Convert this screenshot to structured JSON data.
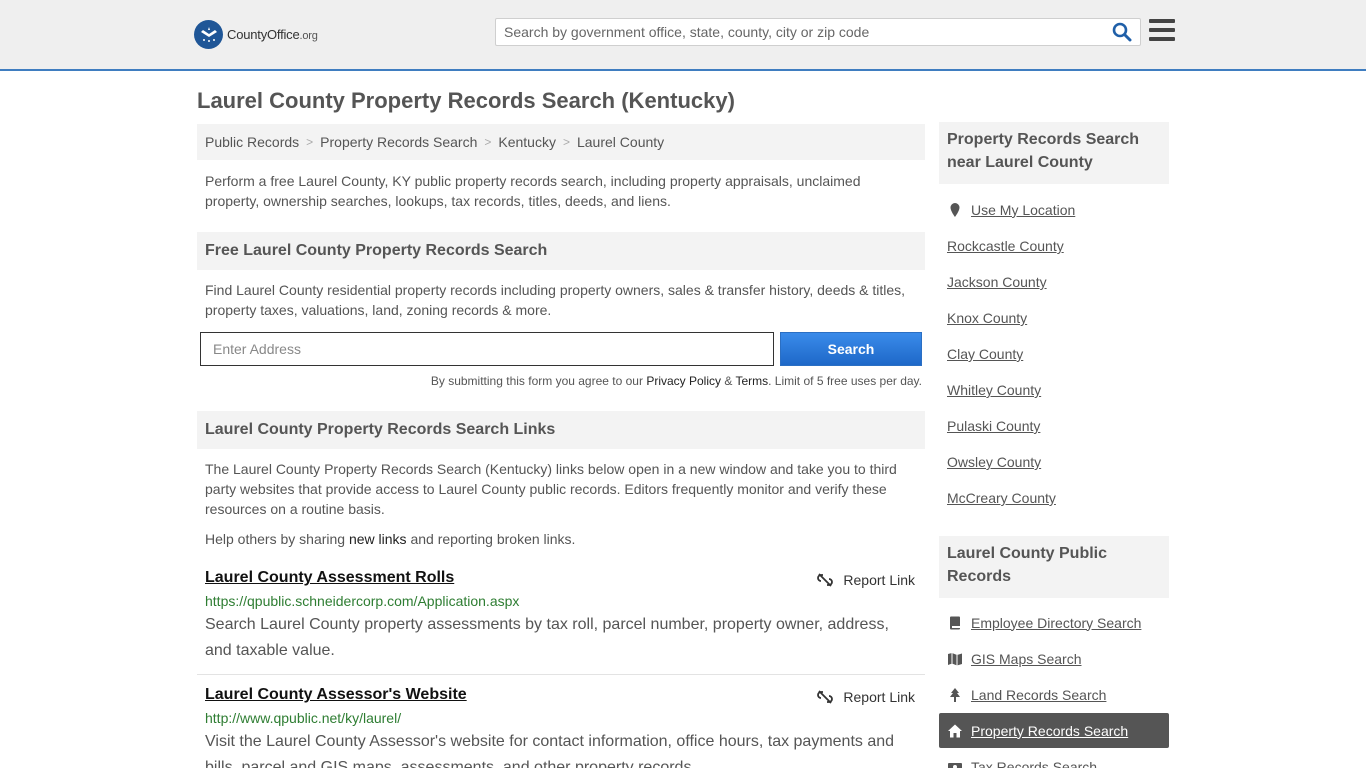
{
  "header": {
    "logo_main": "CountyOffice",
    "logo_tld": ".org",
    "search_placeholder": "Search by government office, state, county, city or zip code"
  },
  "page": {
    "title": "Laurel County Property Records Search (Kentucky)",
    "breadcrumb": [
      "Public Records",
      "Property Records Search",
      "Kentucky",
      "Laurel County"
    ],
    "intro": "Perform a free Laurel County, KY public property records search, including property appraisals, unclaimed property, ownership searches, lookups, tax records, titles, deeds, and liens."
  },
  "free_search": {
    "heading": "Free Laurel County Property Records Search",
    "description": "Find Laurel County residential property records including property owners, sales & transfer history, deeds & titles, property taxes, valuations, land, zoning records & more.",
    "address_placeholder": "Enter Address",
    "button_label": "Search",
    "disclaimer_pre": "By submitting this form you agree to our ",
    "privacy_label": "Privacy Policy",
    "amp": " & ",
    "terms_label": "Terms",
    "disclaimer_post": ". Limit of 5 free uses per day."
  },
  "links_section": {
    "heading": "Laurel County Property Records Search Links",
    "description": "The Laurel County Property Records Search (Kentucky) links below open in a new window and take you to third party websites that provide access to Laurel County public records. Editors frequently monitor and verify these resources on a routine basis.",
    "help_pre": "Help others by sharing ",
    "help_link": "new links",
    "help_post": " and reporting broken links.",
    "report_label": "Report Link",
    "items": [
      {
        "title": "Laurel County Assessment Rolls",
        "url": "https://qpublic.schneidercorp.com/Application.aspx",
        "description": "Search Laurel County property assessments by tax roll, parcel number, property owner, address, and taxable value."
      },
      {
        "title": "Laurel County Assessor's Website",
        "url": "http://www.qpublic.net/ky/laurel/",
        "description": "Visit the Laurel County Assessor's website for contact information, office hours, tax payments and bills, parcel and GIS maps, assessments, and other property records."
      }
    ]
  },
  "sidebar": {
    "nearby_heading": "Property Records Search near Laurel County",
    "use_location": "Use My Location",
    "nearby": [
      "Rockcastle County",
      "Jackson County",
      "Knox County",
      "Clay County",
      "Whitley County",
      "Pulaski County",
      "Owsley County",
      "McCreary County"
    ],
    "public_heading": "Laurel County Public Records",
    "public_records": [
      {
        "label": "Employee Directory Search",
        "icon": "book-icon"
      },
      {
        "label": "GIS Maps Search",
        "icon": "map-icon"
      },
      {
        "label": "Land Records Search",
        "icon": "tree-icon"
      },
      {
        "label": "Property Records Search",
        "icon": "home-icon"
      },
      {
        "label": "Tax Records Search",
        "icon": "money-icon"
      }
    ]
  },
  "colors": {
    "accent": "#3f7dc0",
    "button": "#1e68c8",
    "url_green": "#2e7d32",
    "active_bg": "#555555"
  }
}
